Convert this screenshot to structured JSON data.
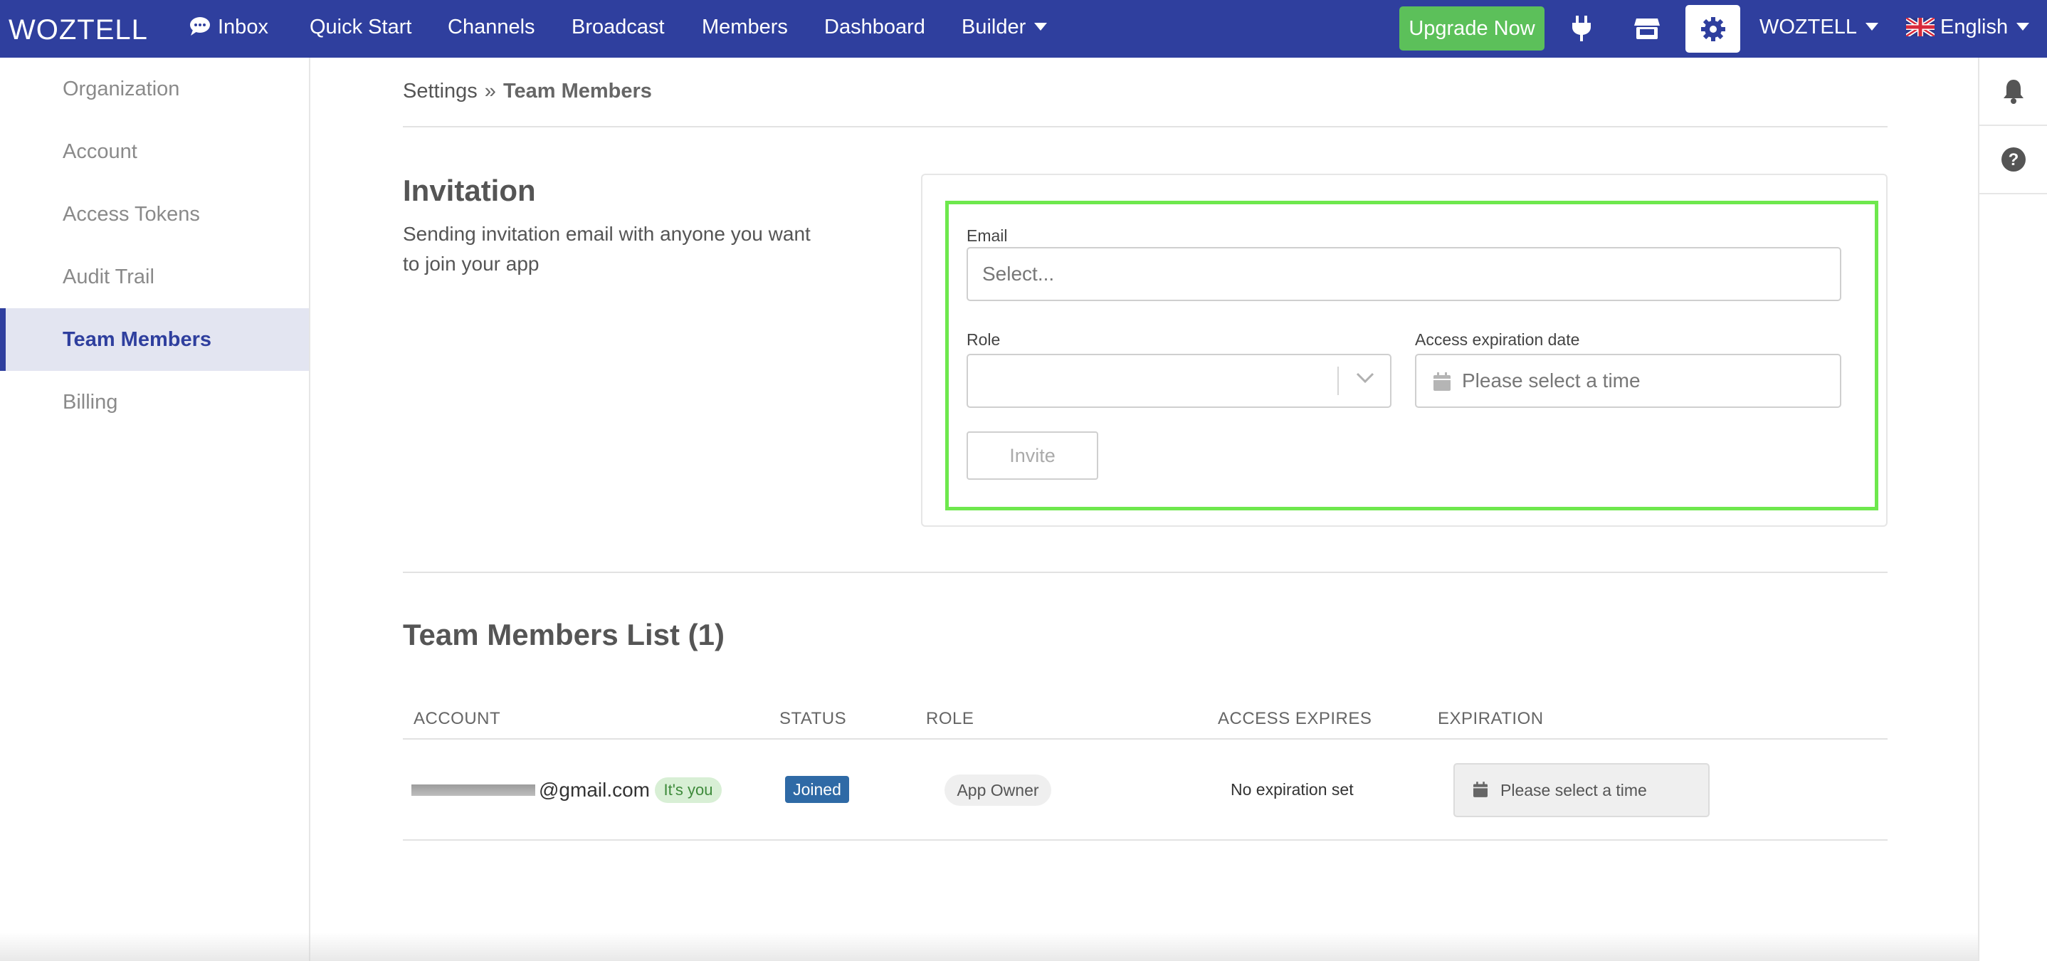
{
  "topnav": {
    "logo": "WOZTELL",
    "items": [
      {
        "label": "Inbox"
      },
      {
        "label": "Quick Start"
      },
      {
        "label": "Channels"
      },
      {
        "label": "Broadcast"
      },
      {
        "label": "Members"
      },
      {
        "label": "Dashboard"
      },
      {
        "label": "Builder"
      }
    ],
    "upgrade_label": "Upgrade Now",
    "account_label": "WOZTELL",
    "language_label": "English",
    "colors": {
      "bar": "#2f3f9e",
      "upgrade": "#5cc05a"
    }
  },
  "sidebar": {
    "items": [
      {
        "label": "Organization"
      },
      {
        "label": "Account"
      },
      {
        "label": "Access Tokens"
      },
      {
        "label": "Audit Trail"
      },
      {
        "label": "Team Members",
        "active": true
      },
      {
        "label": "Billing"
      }
    ]
  },
  "breadcrumb": {
    "parent": "Settings",
    "separator": "»",
    "current": "Team Members"
  },
  "invitation": {
    "title": "Invitation",
    "description": "Sending invitation email with anyone you want to join your app",
    "email_label": "Email",
    "email_placeholder": "Select...",
    "role_label": "Role",
    "role_value": "",
    "expiration_label": "Access expiration date",
    "expiration_placeholder": "Please select a time",
    "invite_button": "Invite",
    "highlight_color": "#6ee84d"
  },
  "members": {
    "title": "Team Members List (1)",
    "columns": [
      "ACCOUNT",
      "STATUS",
      "ROLE",
      "ACCESS EXPIRES",
      "EXPIRATION"
    ],
    "rows": [
      {
        "account_suffix": "@gmail.com",
        "you_badge": "It's you",
        "status": "Joined",
        "role": "App Owner",
        "access_expires": "No expiration set",
        "expiration_placeholder": "Please select a time"
      }
    ]
  }
}
